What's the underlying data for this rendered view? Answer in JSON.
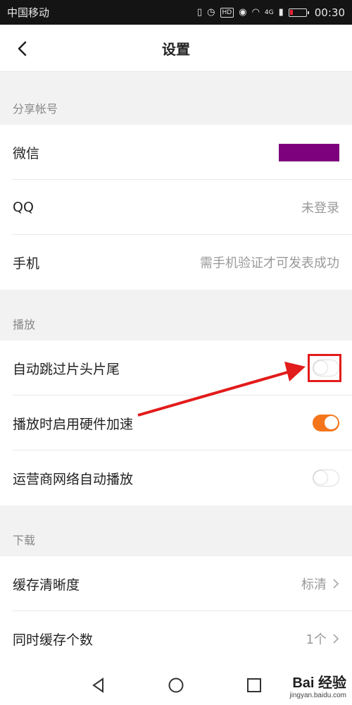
{
  "status_bar": {
    "carrier": "中国移动",
    "network": "4G",
    "time": "00:30"
  },
  "header": {
    "title": "设置"
  },
  "sections": {
    "share": {
      "title": "分享帐号",
      "wechat_label": "微信",
      "qq_label": "QQ",
      "qq_value": "未登录",
      "phone_label": "手机",
      "phone_value": "需手机验证才可发表成功"
    },
    "playback": {
      "title": "播放",
      "skip_label": "自动跳过片头片尾",
      "skip_on": false,
      "hw_label": "播放时启用硬件加速",
      "hw_on": true,
      "carrier_label": "运营商网络自动播放",
      "carrier_on": false
    },
    "download": {
      "title": "下载",
      "quality_label": "缓存清晰度",
      "quality_value": "标清",
      "count_label": "同时缓存个数",
      "count_value": "1个"
    }
  },
  "watermark": {
    "main": "Bai 经验",
    "sub": "jingyan.baidu.com"
  },
  "colors": {
    "toggle_on": "#f5761a",
    "annotation": "#e21b1b",
    "redaction": "#7d007d"
  }
}
